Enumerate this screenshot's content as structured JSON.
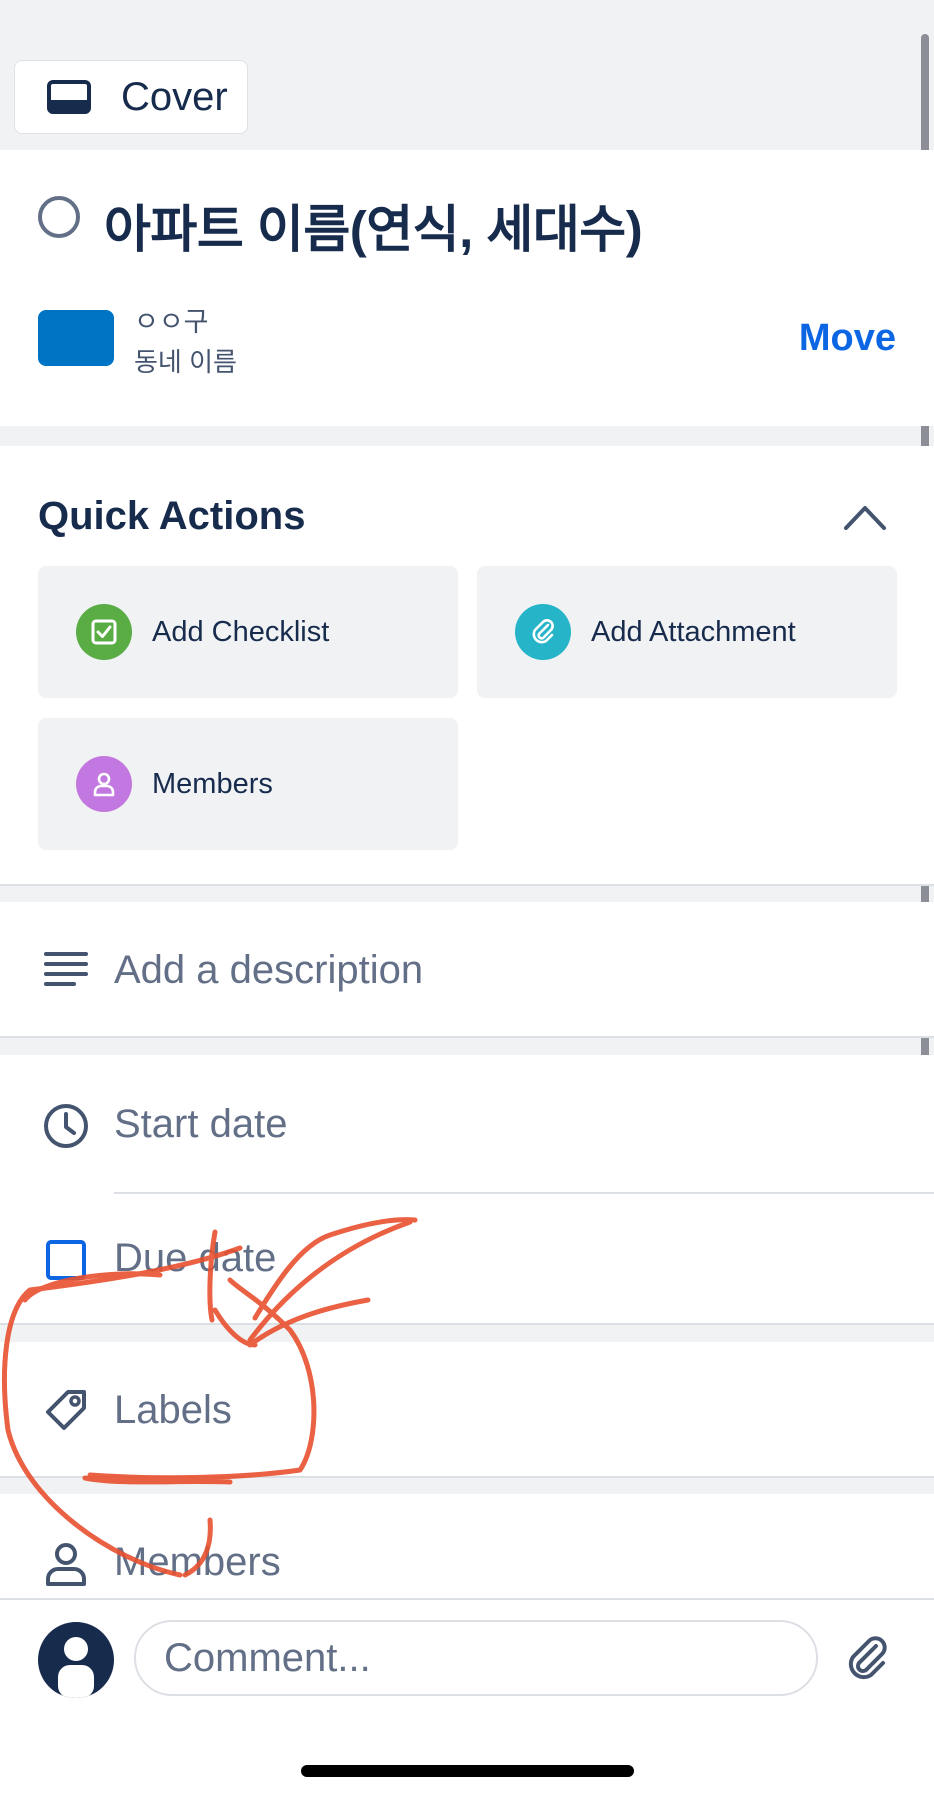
{
  "cover": {
    "label": "Cover",
    "icon": "cover-icon"
  },
  "card": {
    "title": "아파트 이름(연식, 세대수)",
    "board_name": "ㅇㅇ구",
    "list_name": "동네 이름",
    "board_color": "#0074c4",
    "move_label": "Move"
  },
  "quick_actions": {
    "title": "Quick Actions",
    "items": [
      {
        "label": "Add Checklist",
        "icon": "checklist-icon",
        "color": "#5aac44"
      },
      {
        "label": "Add Attachment",
        "icon": "paperclip-icon",
        "color": "#26b4c9"
      },
      {
        "label": "Members",
        "icon": "person-icon",
        "color": "#c377e0"
      }
    ]
  },
  "description": {
    "placeholder": "Add a description"
  },
  "dates": {
    "start": "Start date",
    "due": "Due date"
  },
  "labels": {
    "label": "Labels"
  },
  "members": {
    "label": "Members"
  },
  "comment": {
    "placeholder": "Comment..."
  },
  "colors": {
    "accent": "#0c66e4",
    "text": "#172b4d",
    "muted": "#626f86",
    "annotation": "#e8502f"
  }
}
